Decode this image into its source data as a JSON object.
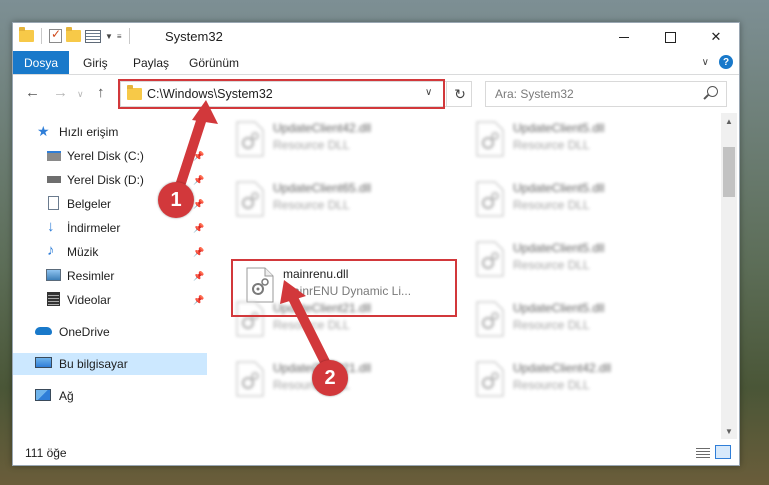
{
  "window": {
    "title": "System32"
  },
  "ribbon": {
    "tabs": [
      "Dosya",
      "Giriş",
      "Paylaş",
      "Görünüm"
    ]
  },
  "address": {
    "path": "C:\\Windows\\System32"
  },
  "search": {
    "placeholder": "Ara: System32"
  },
  "sidebar": {
    "items": [
      {
        "label": "Hızlı erişim",
        "icon": "star-icon",
        "pinned": false
      },
      {
        "label": "Yerel Disk (C:)",
        "icon": "drive-icon",
        "pinned": true
      },
      {
        "label": "Yerel Disk (D:)",
        "icon": "drive-icon",
        "pinned": true
      },
      {
        "label": "Belgeler",
        "icon": "documents-icon",
        "pinned": true
      },
      {
        "label": "İndirmeler",
        "icon": "download-icon",
        "pinned": true
      },
      {
        "label": "Müzik",
        "icon": "music-icon",
        "pinned": true
      },
      {
        "label": "Resimler",
        "icon": "pictures-icon",
        "pinned": true
      },
      {
        "label": "Videolar",
        "icon": "videos-icon",
        "pinned": true
      },
      {
        "label": "OneDrive",
        "icon": "cloud-icon",
        "pinned": false
      },
      {
        "label": "Bu bilgisayar",
        "icon": "computer-icon",
        "pinned": false
      },
      {
        "label": "Ağ",
        "icon": "network-icon",
        "pinned": false
      }
    ]
  },
  "files": [
    {
      "name": "UpdateClient42.dll",
      "desc": "Resource DLL"
    },
    {
      "name": "UpdateClient5.dll",
      "desc": "Resource DLL"
    },
    {
      "name": "UpdateClient65.dll",
      "desc": "Resource DLL"
    },
    {
      "name": "UpdateClient5.dll",
      "desc": "Resource DLL"
    },
    {
      "name": "mainrenu.dll",
      "desc": "MainrENU Dynamic Li..."
    },
    {
      "name": "UpdateClient5.dll",
      "desc": "Resource DLL"
    },
    {
      "name": "UpdateClient21.dll",
      "desc": "Resource DLL"
    },
    {
      "name": "UpdateClient5.dll",
      "desc": "Resource DLL"
    },
    {
      "name": "UpdateClient21.dll",
      "desc": "Resource DLL"
    },
    {
      "name": "UpdateClient42.dll",
      "desc": "Resource DLL"
    }
  ],
  "status": {
    "count": "111 öğe"
  },
  "annotations": {
    "step1": "1",
    "step2": "2"
  },
  "colors": {
    "accent": "#1979ca",
    "highlight": "#d2383b",
    "selection": "#cce8ff"
  }
}
